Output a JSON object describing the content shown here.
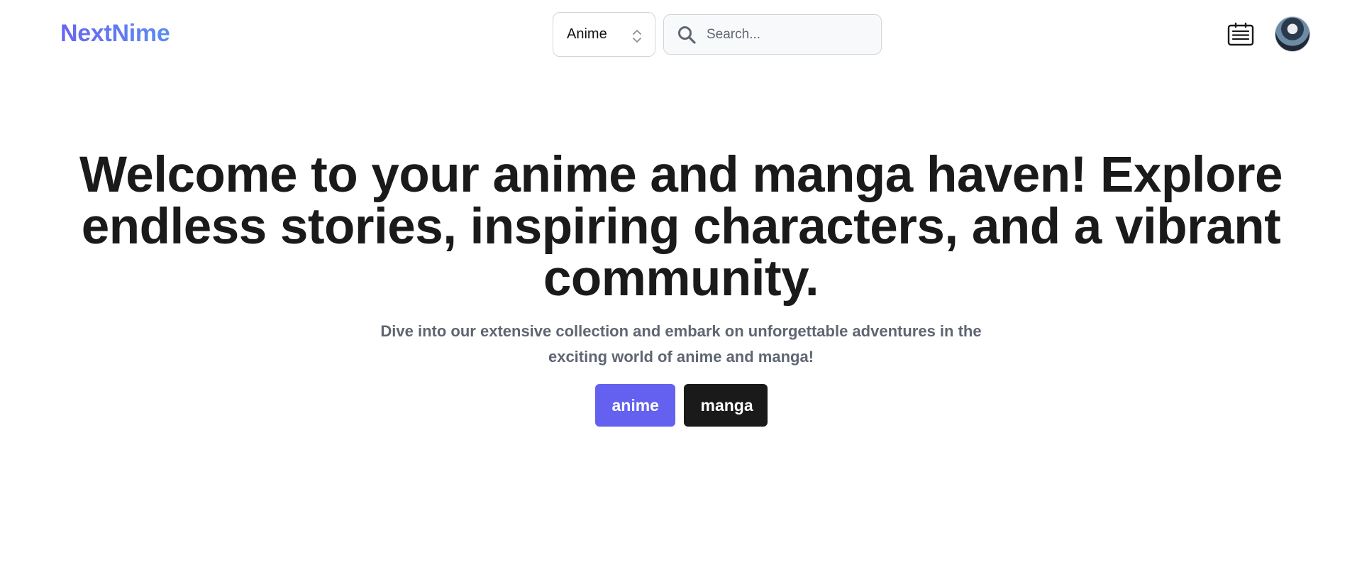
{
  "brand": {
    "name": "NextNime"
  },
  "header": {
    "type_select": {
      "value": "Anime",
      "options": [
        "Anime"
      ]
    },
    "search": {
      "placeholder": "Search...",
      "value": ""
    },
    "icons": [
      "news-icon",
      "search-icon",
      "chevron-updown-icon",
      "avatar"
    ]
  },
  "hero": {
    "title": "Welcome to your anime and manga haven! Explore endless stories, inspiring characters, and a vibrant community.",
    "subtitle": "Dive into our extensive collection and embark on unforgettable adventures in the exciting world of anime and manga!",
    "buttons": {
      "anime_label": "anime",
      "manga_label": "manga"
    }
  },
  "colors": {
    "brand_start": "#6a64f1",
    "brand_end": "#5b8def",
    "anime_button": "#6461f0",
    "manga_button": "#1a1a1a",
    "subtitle_text": "#5f6672",
    "heading_text": "#1a1a1a"
  }
}
